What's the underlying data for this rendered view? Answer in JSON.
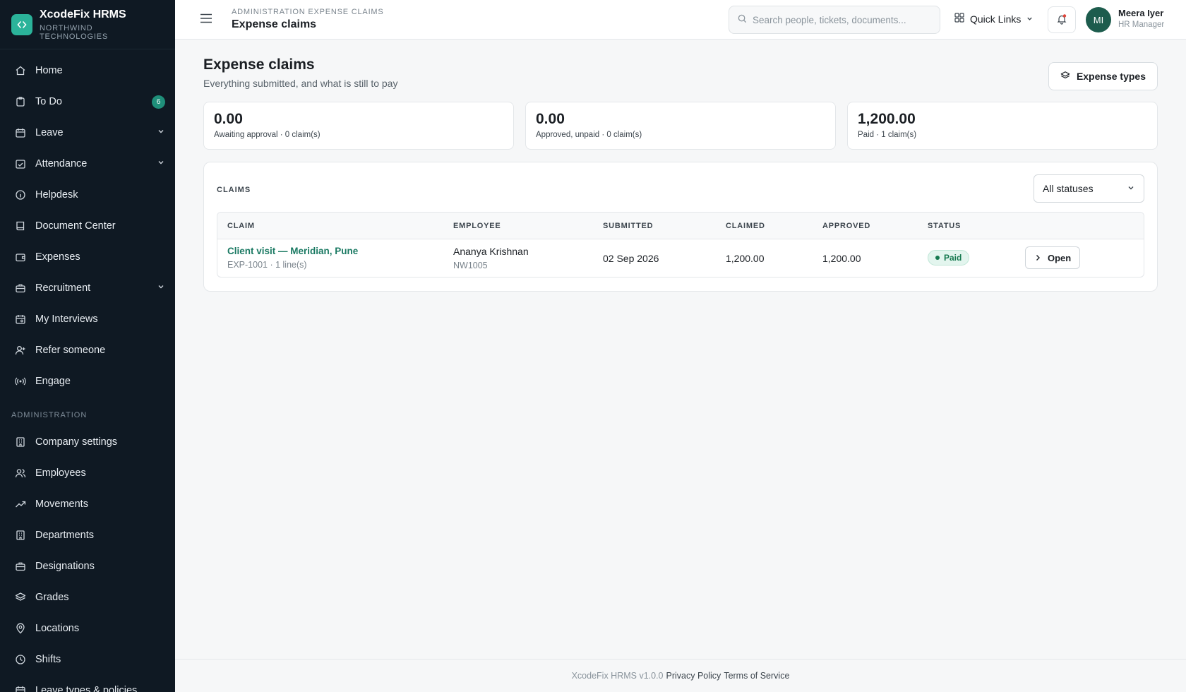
{
  "brand": {
    "name": "XcodeFix HRMS",
    "company": "NORTHWIND TECHNOLOGIES"
  },
  "sidebar": {
    "items": [
      {
        "label": "Home",
        "icon": "home-icon"
      },
      {
        "label": "To Do",
        "icon": "clipboard-icon",
        "badge": "6"
      },
      {
        "label": "Leave",
        "icon": "calendar-icon",
        "chevron": true
      },
      {
        "label": "Attendance",
        "icon": "calendar-check-icon",
        "chevron": true
      },
      {
        "label": "Helpdesk",
        "icon": "info-icon"
      },
      {
        "label": "Document Center",
        "icon": "book-icon"
      },
      {
        "label": "Expenses",
        "icon": "wallet-icon"
      },
      {
        "label": "Recruitment",
        "icon": "briefcase-icon",
        "chevron": true
      },
      {
        "label": "My Interviews",
        "icon": "calendar-clock-icon"
      },
      {
        "label": "Refer someone",
        "icon": "user-plus-icon"
      },
      {
        "label": "Engage",
        "icon": "broadcast-icon"
      }
    ],
    "admin_section": "ADMINISTRATION",
    "admin_items": [
      {
        "label": "Company settings",
        "icon": "building-icon"
      },
      {
        "label": "Employees",
        "icon": "users-icon"
      },
      {
        "label": "Movements",
        "icon": "trend-icon"
      },
      {
        "label": "Departments",
        "icon": "building-icon"
      },
      {
        "label": "Designations",
        "icon": "briefcase-icon"
      },
      {
        "label": "Grades",
        "icon": "layers-icon"
      },
      {
        "label": "Locations",
        "icon": "map-pin-icon"
      },
      {
        "label": "Shifts",
        "icon": "clock-icon"
      },
      {
        "label": "Leave types & policies",
        "icon": "calendar-icon"
      }
    ]
  },
  "topbar": {
    "breadcrumb": "ADMINISTRATION EXPENSE CLAIMS",
    "title": "Expense claims",
    "search_placeholder": "Search people, tickets, documents...",
    "quick_links": "Quick Links",
    "user_initials": "MI",
    "user_name": "Meera Iyer",
    "user_role": "HR Manager"
  },
  "page": {
    "title": "Expense claims",
    "subtitle": "Everything submitted, and what is still to pay",
    "types_button": "Expense types"
  },
  "stats": [
    {
      "value": "0.00",
      "label": "Awaiting approval · 0 claim(s)"
    },
    {
      "value": "0.00",
      "label": "Approved, unpaid · 0 claim(s)"
    },
    {
      "value": "1,200.00",
      "label": "Paid · 1 claim(s)"
    }
  ],
  "claims": {
    "section_title": "CLAIMS",
    "status_filter": "All statuses",
    "columns": [
      "CLAIM",
      "EMPLOYEE",
      "SUBMITTED",
      "CLAIMED",
      "APPROVED",
      "STATUS"
    ],
    "rows": [
      {
        "title": "Client visit — Meridian, Pune",
        "ref": "EXP-1001 · 1 line(s)",
        "employee": "Ananya Krishnan",
        "employee_id": "NW1005",
        "submitted": "02 Sep 2026",
        "claimed": "1,200.00",
        "approved": "1,200.00",
        "status": "Paid",
        "action": "Open"
      }
    ]
  },
  "footer": {
    "version": "XcodeFix HRMS v1.0.0",
    "privacy": "Privacy Policy",
    "terms": "Terms of Service"
  },
  "colors": {
    "sidebar": "#0f1923",
    "accent": "#1b7a63",
    "brand": "#2bb39a"
  }
}
